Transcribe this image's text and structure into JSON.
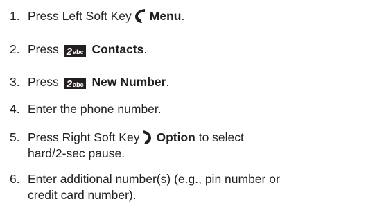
{
  "steps": [
    {
      "num": "1.",
      "pre": "Press Left Soft Key",
      "bold": "Menu",
      "post": "."
    },
    {
      "num": "2.",
      "pre": "Press",
      "key": {
        "main": "2",
        "sub": "abc"
      },
      "bold": "Contacts",
      "post": "."
    },
    {
      "num": "3.",
      "pre": "Press",
      "key": {
        "main": "2",
        "sub": "abc"
      },
      "bold": "New Number",
      "post": "."
    },
    {
      "num": "4.",
      "text": "Enter the phone number."
    },
    {
      "num": "5.",
      "pre": "Press Right Soft Key",
      "bold": "Option",
      "post": " to select",
      "line2": "hard/2-sec pause."
    },
    {
      "num": "6.",
      "text": "Enter additional number(s) (e.g., pin number or",
      "line2": "credit card number)."
    }
  ],
  "icons": {
    "left_soft_key": "left-soft-key-icon",
    "right_soft_key": "right-soft-key-icon"
  },
  "colors": {
    "text": "#231f20",
    "key_bg": "#231f20",
    "key_fg": "#ffffff"
  }
}
